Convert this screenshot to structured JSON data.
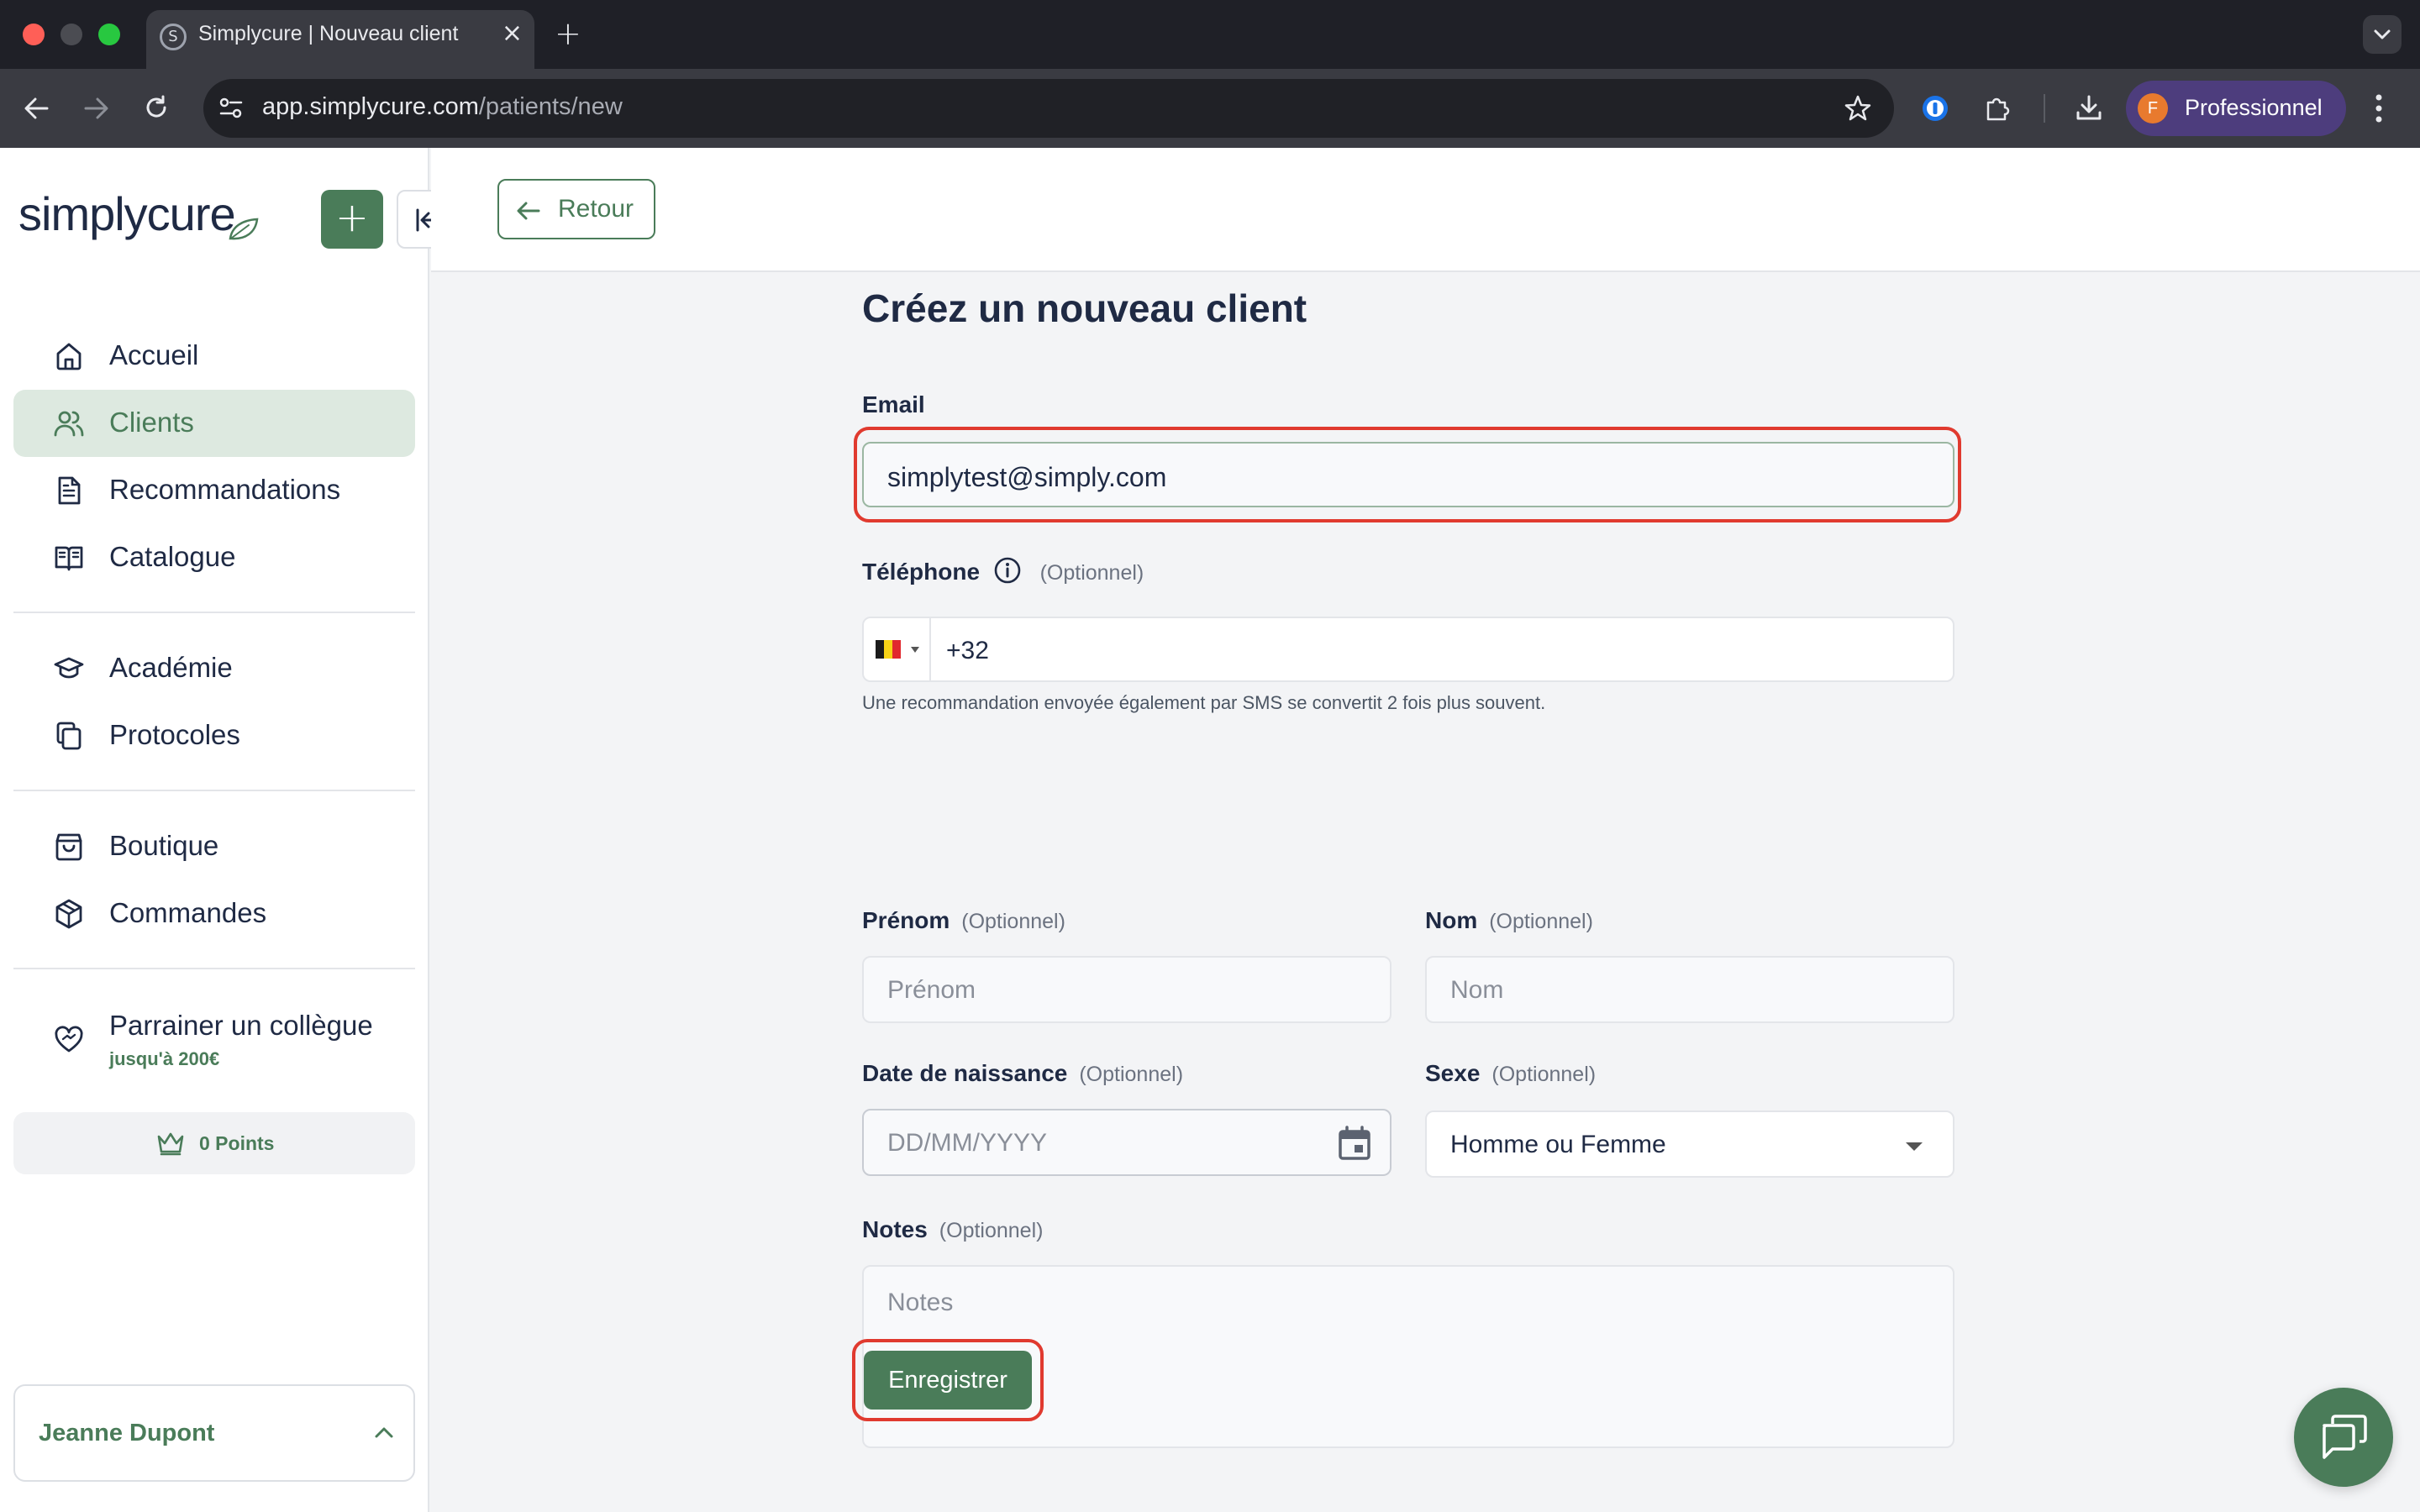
{
  "browser": {
    "tab_title": "Simplycure | Nouveau client",
    "tab_favicon": "S",
    "tab_close": "×",
    "new_tab": "+",
    "url_host": "app.simplycure.com",
    "url_path": "/patients/new",
    "profile_initial": "F",
    "profile_label": "Professionnel",
    "traffic_colors": {
      "close": "#ff5f57",
      "minimize": "#4b4c52",
      "maximize": "#28c840"
    }
  },
  "sidebar": {
    "logo": "simplycure",
    "add_label": "+",
    "nav_groups": [
      [
        {
          "label": "Accueil",
          "icon": "home-icon"
        },
        {
          "label": "Clients",
          "icon": "users-icon",
          "active": true
        },
        {
          "label": "Recommandations",
          "icon": "document-icon"
        },
        {
          "label": "Catalogue",
          "icon": "book-icon"
        }
      ],
      [
        {
          "label": "Académie",
          "icon": "graduation-cap-icon"
        },
        {
          "label": "Protocoles",
          "icon": "copy-icon"
        }
      ],
      [
        {
          "label": "Boutique",
          "icon": "shopping-bag-icon"
        },
        {
          "label": "Commandes",
          "icon": "package-icon"
        }
      ]
    ],
    "referral": {
      "label": "Parrainer un collègue",
      "sub": "jusqu'à 200€"
    },
    "points": "0 Points",
    "user": "Jeanne Dupont"
  },
  "topbar": {
    "back_label": "Retour"
  },
  "form": {
    "title": "Créez un nouveau client",
    "email": {
      "label": "Email",
      "value": "simplytest@simply.com"
    },
    "phone": {
      "label": "Téléphone",
      "optional": "(Optionnel)",
      "value": "+32",
      "hint": "Une recommandation envoyée également par SMS se convertit 2 fois plus souvent."
    },
    "firstname": {
      "label": "Prénom",
      "optional": "(Optionnel)",
      "placeholder": "Prénom"
    },
    "lastname": {
      "label": "Nom",
      "optional": "(Optionnel)",
      "placeholder": "Nom"
    },
    "dob": {
      "label": "Date de naissance",
      "optional": "(Optionnel)",
      "placeholder": "DD/MM/YYYY"
    },
    "sex": {
      "label": "Sexe",
      "optional": "(Optionnel)",
      "value": "Homme ou Femme"
    },
    "notes": {
      "label": "Notes",
      "optional": "(Optionnel)",
      "placeholder": "Notes"
    },
    "save_label": "Enregistrer"
  },
  "theme": {
    "accent": "#4a7c59",
    "highlight": "#e03a2f",
    "text": "#1f2a44"
  }
}
